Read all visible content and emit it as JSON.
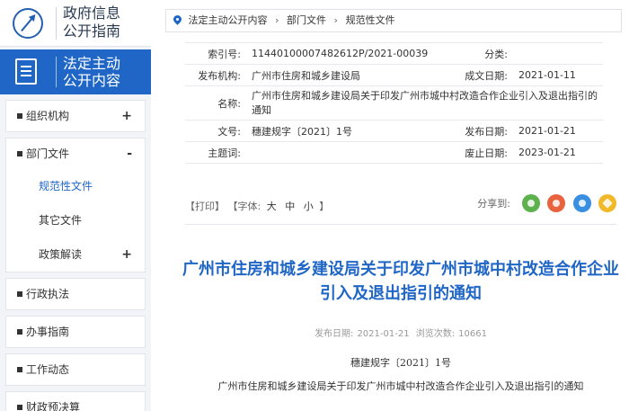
{
  "sidebar": {
    "guide": {
      "line1": "政府信息",
      "line2": "公开指南"
    },
    "active": {
      "line1": "法定主动",
      "line2": "公开内容"
    },
    "menu": [
      {
        "label": "组织机构",
        "toggle": "+"
      },
      {
        "label": "部门文件",
        "toggle": "-",
        "children": [
          {
            "label": "规范性文件"
          },
          {
            "label": "其它文件"
          },
          {
            "label": "政策解读",
            "toggle": "+"
          }
        ]
      },
      {
        "label": "行政执法"
      },
      {
        "label": "办事指南"
      },
      {
        "label": "工作动态"
      },
      {
        "label": "财政预决算"
      }
    ]
  },
  "breadcrumb": [
    "法定主动公开内容",
    "部门文件",
    "规范性文件"
  ],
  "meta": {
    "index_label": "索引号:",
    "index_value": "11440100007482612P/2021-00039",
    "category_label": "分类:",
    "category_value": "",
    "agency_label": "发布机构:",
    "agency_value": "广州市住房和城乡建设局",
    "written_label": "成文日期:",
    "written_value": "2021-01-11",
    "name_label": "名称:",
    "name_value": "广州市住房和城乡建设局关于印发广州市城中村改造合作企业引入及退出指引的通知",
    "docno_label": "文号:",
    "docno_value": "穗建规字〔2021〕1号",
    "published_label": "发布日期:",
    "published_value": "2021-01-21",
    "topic_label": "主题词:",
    "topic_value": "",
    "expiry_label": "废止日期:",
    "expiry_value": "2023-01-21"
  },
  "toolbar": {
    "print": "【打印】",
    "font_open": "【字体:",
    "font_large": "大",
    "font_medium": "中",
    "font_small": "小",
    "font_close": "】",
    "share_label": "分享到:",
    "share_icons": [
      "wechat-icon",
      "weibo-icon",
      "qq-icon",
      "qzone-icon"
    ]
  },
  "article": {
    "title": "广州市住房和城乡建设局关于印发广州市城中村改造合作企业引入及退出指引的通知",
    "pub_date_label": "发布日期:",
    "pub_date": "2021-01-21",
    "views_label": "浏览次数:",
    "views": "10661",
    "doc_number": "穗建规字〔2021〕1号",
    "subtitle": "广州市住房和城乡建设局关于印发广州市城中村改造合作企业引入及退出指引的通知"
  }
}
